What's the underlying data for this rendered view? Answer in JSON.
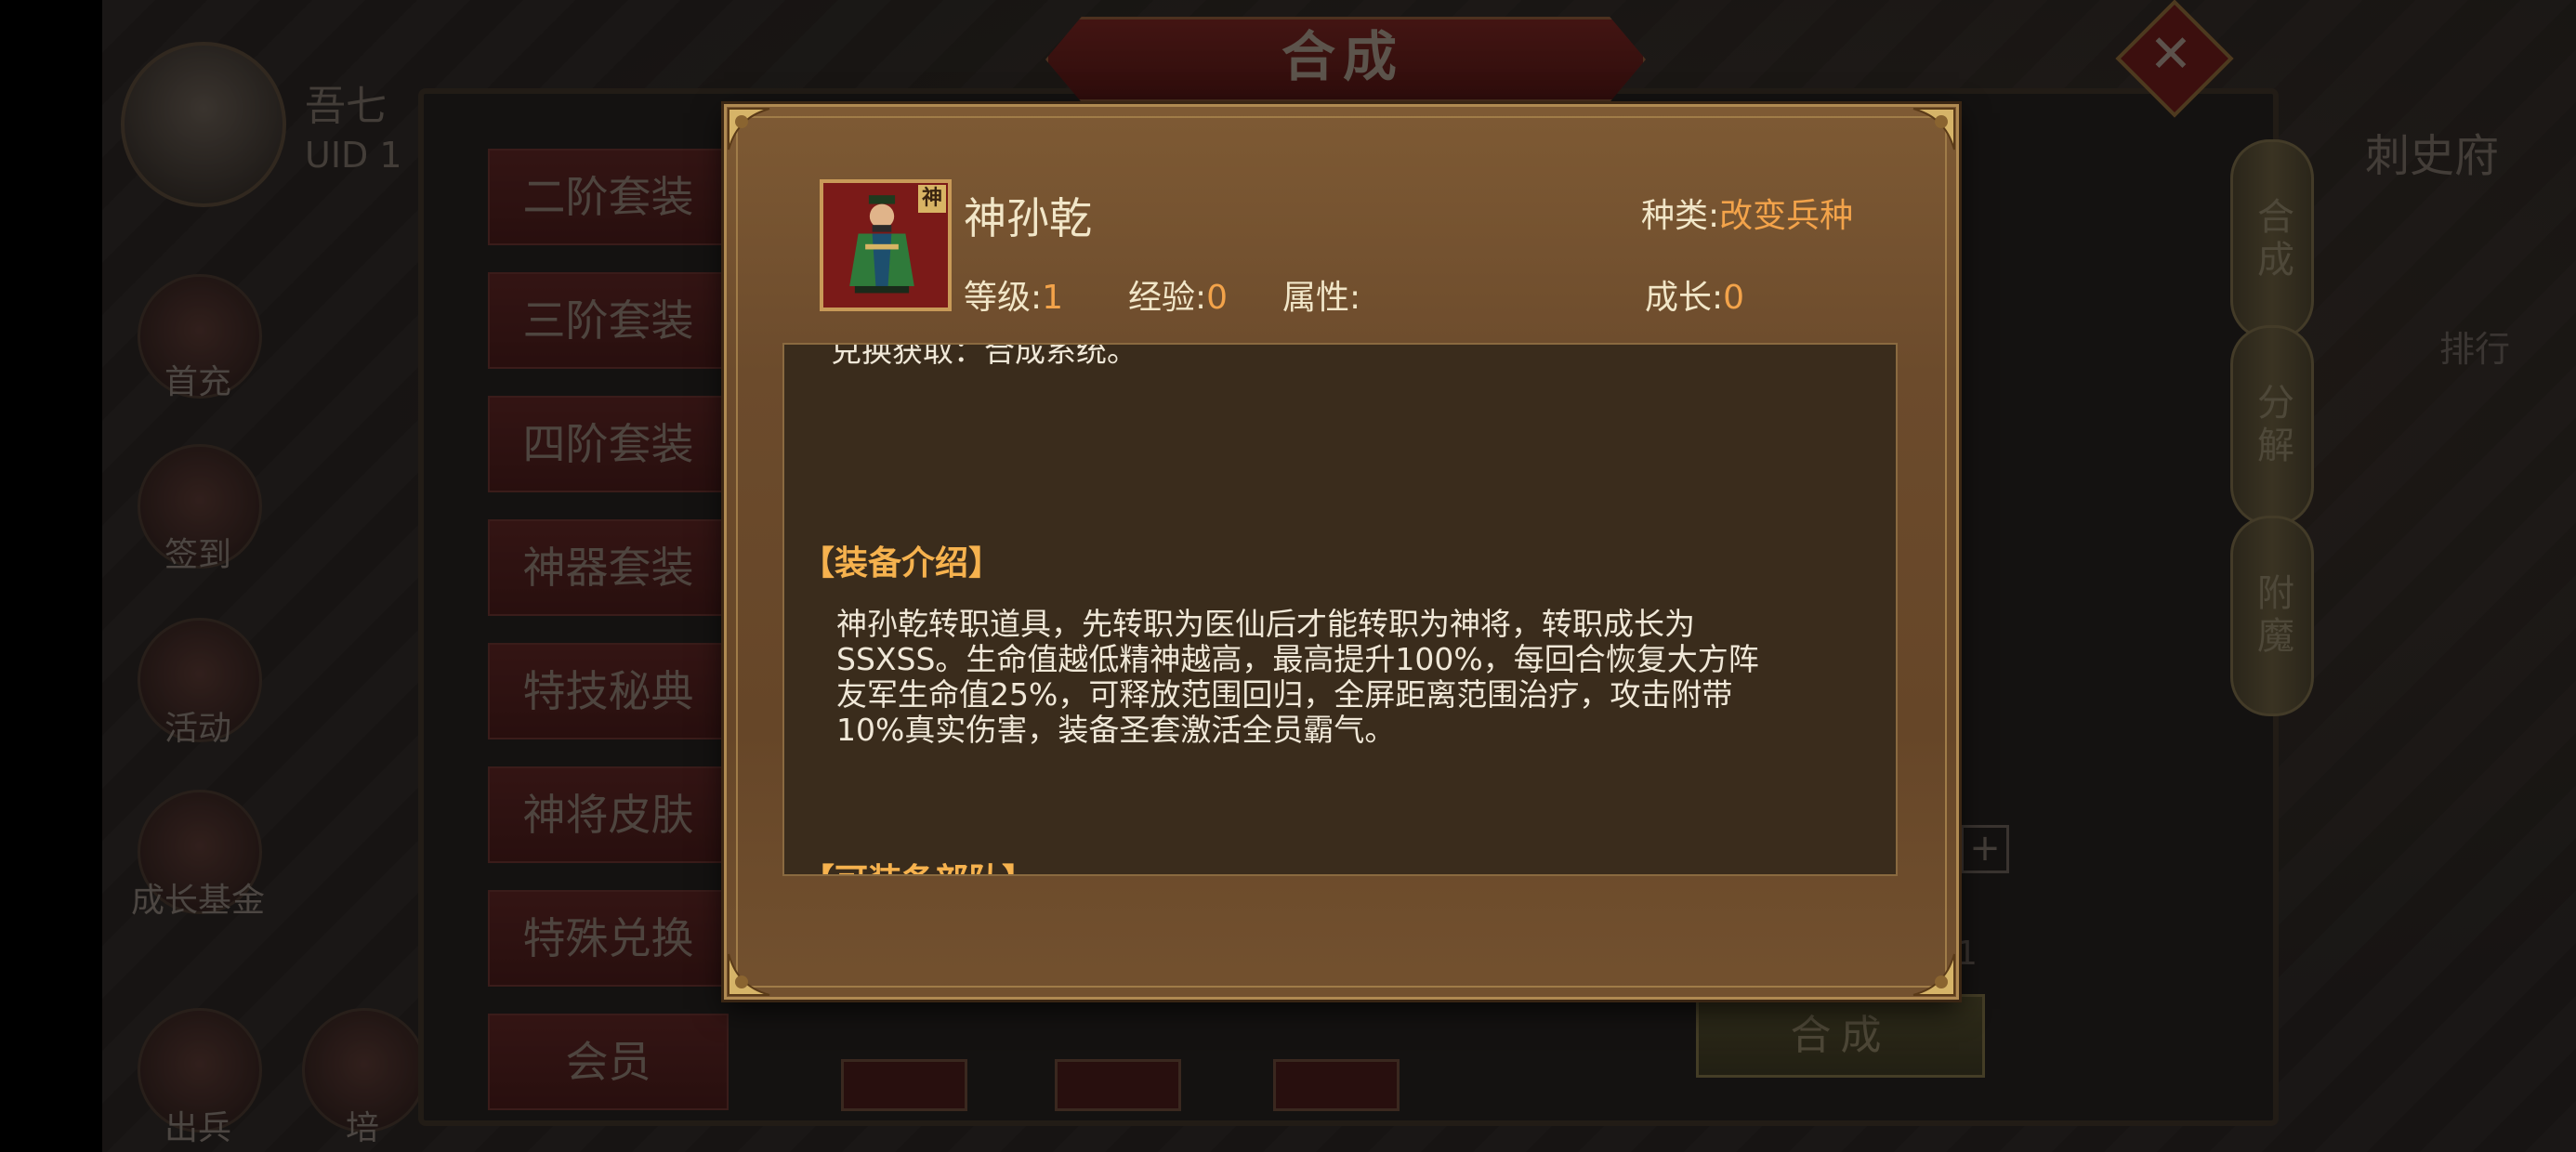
{
  "background": {
    "title": "合成",
    "user": {
      "name": "吾七",
      "uid": "UID 1"
    },
    "left_icons": [
      {
        "label": "首充",
        "name": "first-recharge-icon"
      },
      {
        "label": "签到",
        "name": "sign-in-icon"
      },
      {
        "label": "活动",
        "name": "activity-icon"
      },
      {
        "label": "成长基金",
        "name": "growth-fund-icon"
      },
      {
        "label": "出兵",
        "name": "dispatch-icon"
      },
      {
        "label": "培",
        "name": "train-icon"
      }
    ],
    "category_tabs": [
      "二阶套装",
      "三阶套装",
      "四阶套装",
      "神器套装",
      "特技秘典",
      "神将皮肤",
      "特殊兑换",
      "会员"
    ],
    "vertical_tabs": [
      "合成",
      "分解",
      "附魔"
    ],
    "right_city_label": "刺史府",
    "rank_label": "排行",
    "synth_button": "合成",
    "count_value": "1",
    "badge_char": "神"
  },
  "modal": {
    "item_name": "神孙乾",
    "item_badge": "神",
    "type_label": "种类:",
    "type_value": "改变兵种",
    "level_label": "等级:",
    "level_value": "1",
    "exp_label": "经验:",
    "exp_value": "0",
    "attr_label": "属性:",
    "growth_label": "成长:",
    "growth_value": "0",
    "obtain_text": "兑换获取：合成系统。",
    "intro_heading": "【装备介绍】",
    "intro_lines": [
      "神孙乾转职道具，先转职为医仙后才能转职为神将，转职成长为",
      "SSXSS。生命值越低精神越高，最高提升100%，每回合恢复大方阵",
      "友军生命值25%，可释放范围回归，全屏距离范围治疗，攻击附带",
      "10%真实伤害，装备圣套激活全员霸气。"
    ],
    "equip_heading": "【可装备部队】"
  }
}
